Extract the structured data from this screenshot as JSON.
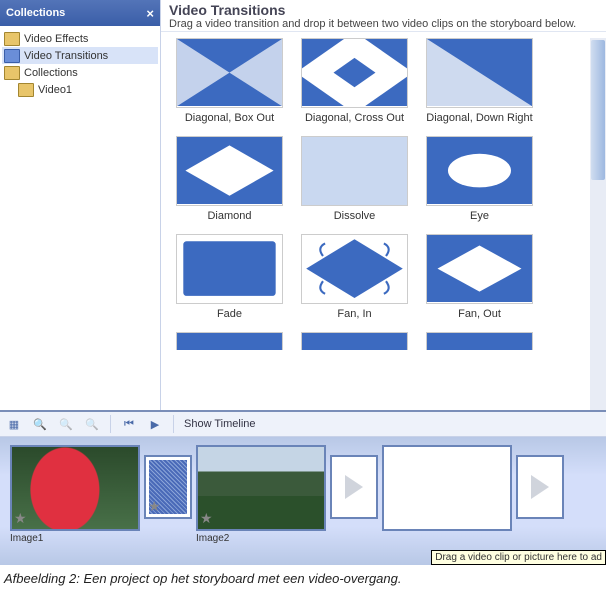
{
  "sidebar": {
    "title": "Collections",
    "items": [
      {
        "label": "Video Effects",
        "selected": false,
        "indent": 0
      },
      {
        "label": "Video Transitions",
        "selected": true,
        "indent": 0
      },
      {
        "label": "Collections",
        "selected": false,
        "indent": 0
      },
      {
        "label": "Video1",
        "selected": false,
        "indent": 1
      }
    ]
  },
  "main": {
    "title": "Video Transitions",
    "subtitle": "Drag a video transition and drop it between two video clips on the storyboard below.",
    "transitions": [
      [
        {
          "label": "Diagonal, Box Out",
          "kind": "diag-box"
        },
        {
          "label": "Diagonal, Cross Out",
          "kind": "dcross"
        },
        {
          "label": "Diagonal, Down Right",
          "kind": "dright"
        }
      ],
      [
        {
          "label": "Diamond",
          "kind": "diamond"
        },
        {
          "label": "Dissolve",
          "kind": "noise",
          "selected": true
        },
        {
          "label": "Eye",
          "kind": "eye"
        }
      ],
      [
        {
          "label": "Fade",
          "kind": "fade"
        },
        {
          "label": "Fan, In",
          "kind": "fanin"
        },
        {
          "label": "Fan, Out",
          "kind": "fanout"
        }
      ],
      [
        {
          "label": "",
          "kind": "peek"
        },
        {
          "label": "",
          "kind": "peek"
        },
        {
          "label": "",
          "kind": "peek"
        }
      ]
    ]
  },
  "toolbar": {
    "show_timeline": "Show Timeline"
  },
  "storyboard": {
    "clips": [
      {
        "label": "Image1",
        "img": "tulip"
      },
      {
        "label": "Image2",
        "img": "landscape"
      }
    ],
    "transition_thumb": "dissolve-small",
    "drag_hint": "Drag a video clip or picture here to ad"
  },
  "caption": "Afbeelding 2: Een project op het storyboard met een video-overgang."
}
